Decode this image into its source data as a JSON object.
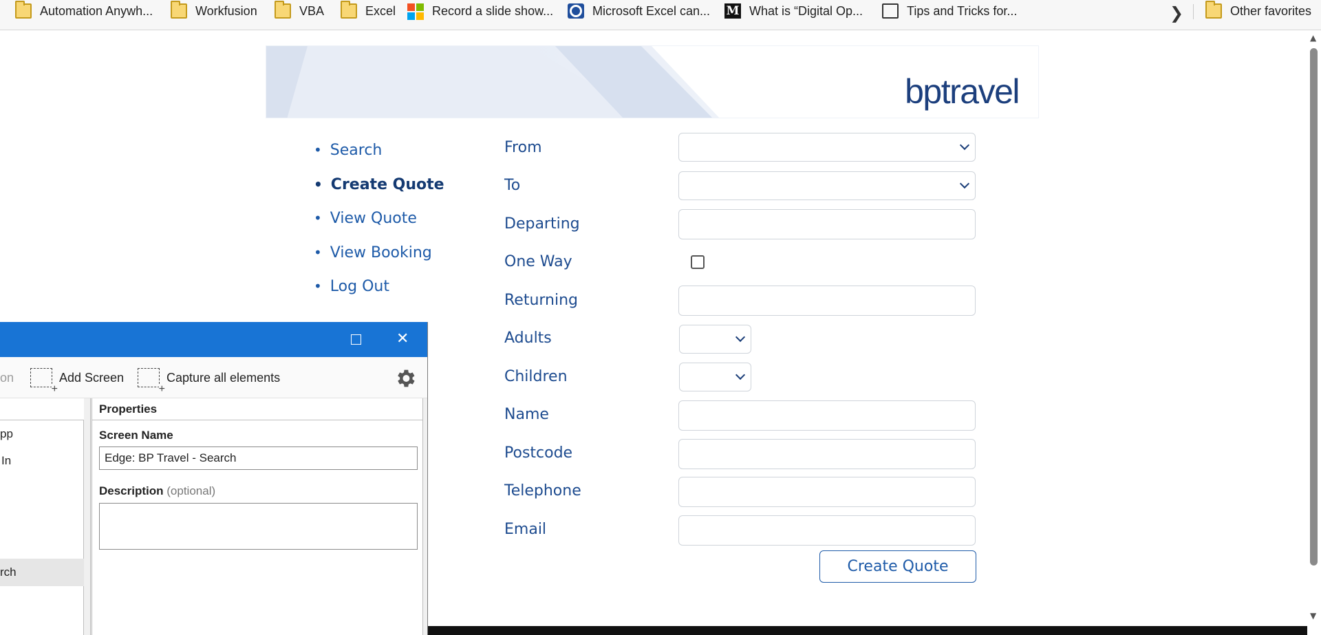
{
  "favorites": [
    {
      "label": "Automation Anywh...",
      "icon": "folder-icon"
    },
    {
      "label": "Workfusion",
      "icon": "folder-icon"
    },
    {
      "label": "VBA",
      "icon": "folder-icon"
    },
    {
      "label": "Excel",
      "icon": "folder-icon"
    },
    {
      "label": "Record a slide show...",
      "icon": "microsoft-icon"
    },
    {
      "label": "Microsoft Excel can...",
      "icon": "circle-logo-icon"
    },
    {
      "label": "What is “Digital Op...",
      "icon": "medium-m-icon"
    },
    {
      "label": "Tips and Tricks for...",
      "icon": "page-icon"
    }
  ],
  "other_favorites": "Other favorites",
  "site": {
    "logo": "bptravel"
  },
  "nav": [
    {
      "label": "Search",
      "active": false
    },
    {
      "label": "Create Quote",
      "active": true
    },
    {
      "label": "View Quote",
      "active": false
    },
    {
      "label": "View Booking",
      "active": false
    },
    {
      "label": "Log Out",
      "active": false
    }
  ],
  "form": {
    "labels": {
      "from": "From",
      "to": "To",
      "departing": "Departing",
      "one_way": "One Way",
      "returning": "Returning",
      "adults": "Adults",
      "children": "Children",
      "name": "Name",
      "postcode": "Postcode",
      "telephone": "Telephone",
      "email": "Email"
    },
    "values": {
      "from": "",
      "to": "",
      "departing": "",
      "one_way": false,
      "returning": "",
      "adults": "",
      "children": "",
      "name": "",
      "postcode": "",
      "telephone": "",
      "email": ""
    },
    "submit_label": "Create Quote"
  },
  "dialog": {
    "toolbar": {
      "partial_left": "on",
      "add_screen": "Add Screen",
      "capture_all": "Capture all elements"
    },
    "tree": {
      "item1": "pp",
      "item2": "In",
      "selected": "rch"
    },
    "properties": {
      "header": "Properties",
      "screen_name_label": "Screen Name",
      "screen_name_value": "Edge: BP Travel - Search",
      "description_label": "Description",
      "description_optional": "(optional)",
      "description_value": ""
    }
  },
  "colors": {
    "accent": "#1d5aa8",
    "logo": "#1c3f7d",
    "dialog_title": "#1874d5"
  }
}
